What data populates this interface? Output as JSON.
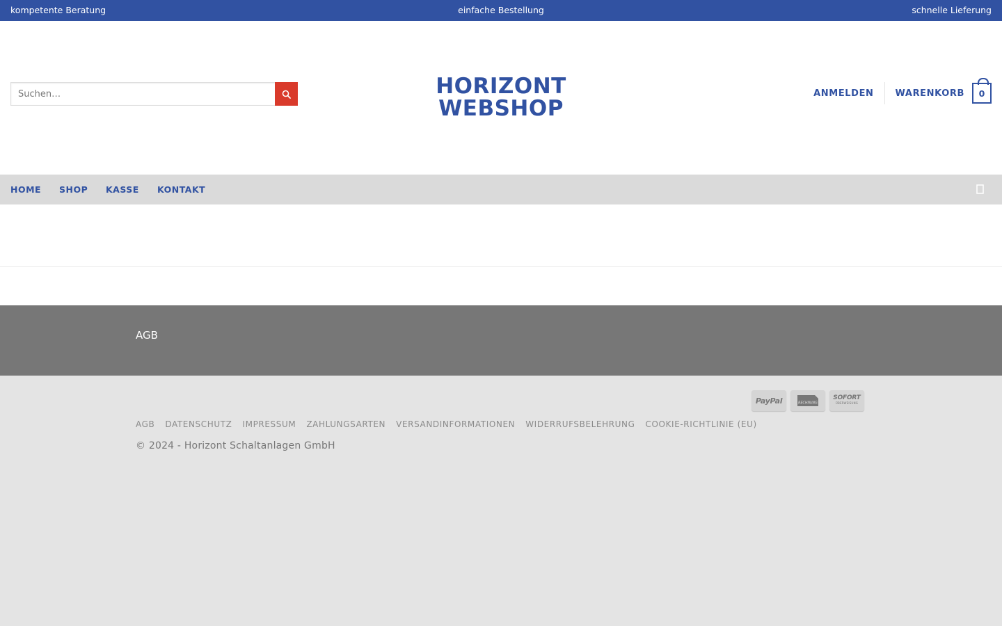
{
  "topbar": {
    "left": "kompetente Beratung",
    "center": "einfache Bestellung",
    "right": "schnelle Lieferung"
  },
  "search": {
    "placeholder": "Suchen…",
    "button_icon": "search-icon"
  },
  "logo": {
    "line1": "HORIZONT",
    "line2": "WEBSHOP"
  },
  "account": {
    "login_label": "ANMELDEN",
    "cart_label": "WARENKORB",
    "cart_count": "0"
  },
  "nav": {
    "items": [
      {
        "label": "HOME"
      },
      {
        "label": "SHOP"
      },
      {
        "label": "KASSE"
      },
      {
        "label": "KONTAKT"
      }
    ],
    "search_icon": "search-icon"
  },
  "footer_widgets": {
    "agb": "AGB"
  },
  "payments": {
    "paypal": "PayPal",
    "invoice": "RECHNUNG",
    "sofort": "SOFORT",
    "sofort_sub": "ÜBERWEISUNG"
  },
  "footer_links": [
    "AGB",
    "DATENSCHUTZ",
    "IMPRESSUM",
    "ZAHLUNGSARTEN",
    "VERSANDINFORMATIONEN",
    "WIDERRUFSBELEHRUNG",
    "COOKIE-RICHTLINIE (EU)"
  ],
  "copyright": "© 2024 - Horizont Schaltanlagen GmbH",
  "colors": {
    "brand": "#3152a2",
    "search_button": "#d93a2b",
    "nav_bg": "#dadada",
    "footer_widgets_bg": "#777777",
    "footer_bg": "#e4e4e4"
  }
}
